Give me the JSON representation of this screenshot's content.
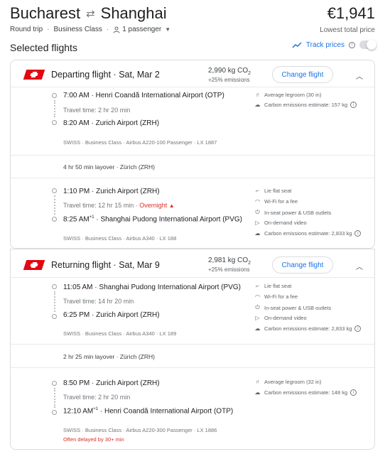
{
  "header": {
    "origin": "Bucharest",
    "swap_icon": "swap-arrows-icon",
    "destination": "Shanghai",
    "price": "€1,941",
    "price_note": "Lowest total price",
    "trip_type": "Round trip",
    "cabin": "Business Class",
    "passengers": "1 passenger"
  },
  "selected_title": "Selected flights",
  "track": {
    "label": "Track prices",
    "enabled": false
  },
  "departing": {
    "title": "Departing flight",
    "date": "Sat, Mar 2",
    "co2": "2,990 kg CO",
    "co2_sub": "2",
    "co2_pct": "+25% emissions",
    "button": "Change flight",
    "seg1": {
      "dep_time": "7:00 AM",
      "dep_airport": "Henri Coandă International Airport (OTP)",
      "travel": "Travel time: 2 hr 20 min",
      "arr_time": "8:20 AM",
      "arr_airport": "Zurich Airport (ZRH)",
      "meta": "SWISS · Business Class · Airbus A220-100 Passenger · LX 1887",
      "amenities": [
        "Average legroom (30 in)",
        "Carbon emissions estimate: 157 kg"
      ]
    },
    "layover": "4 hr 50 min layover · Zürich (ZRH)",
    "seg2": {
      "dep_time": "1:10 PM",
      "dep_airport": "Zurich Airport (ZRH)",
      "travel": "Travel time: 12 hr 15 min",
      "overnight": "Overnight",
      "arr_time": "8:25 AM",
      "arr_plus": "+1",
      "arr_airport": "Shanghai Pudong International Airport (PVG)",
      "meta": "SWISS · Business Class · Airbus A340 · LX 188",
      "amenities": [
        "Lie flat seat",
        "Wi-Fi for a fee",
        "In-seat power & USB outlets",
        "On-demand video",
        "Carbon emissions estimate: 2,833 kg"
      ]
    }
  },
  "returning": {
    "title": "Returning flight",
    "date": "Sat, Mar 9",
    "co2": "2,981 kg CO",
    "co2_sub": "2",
    "co2_pct": "+25% emissions",
    "button": "Change flight",
    "seg1": {
      "dep_time": "11:05 AM",
      "dep_airport": "Shanghai Pudong International Airport (PVG)",
      "travel": "Travel time: 14 hr 20 min",
      "arr_time": "6:25 PM",
      "arr_airport": "Zurich Airport (ZRH)",
      "meta": "SWISS · Business Class · Airbus A340 · LX 189",
      "amenities": [
        "Lie flat seat",
        "Wi-Fi for a fee",
        "In-seat power & USB outlets",
        "On-demand video",
        "Carbon emissions estimate: 2,833 kg"
      ]
    },
    "layover": "2 hr 25 min layover · Zürich (ZRH)",
    "seg2": {
      "dep_time": "8:50 PM",
      "dep_airport": "Zurich Airport (ZRH)",
      "travel": "Travel time: 2 hr 20 min",
      "arr_time": "12:10 AM",
      "arr_plus": "+1",
      "arr_airport": "Henri Coandă International Airport (OTP)",
      "meta": "SWISS · Business Class · Airbus A220-300 Passenger · LX 1886",
      "delay": "Often delayed by 30+ min",
      "amenities": [
        "Average legroom (32 in)",
        "Carbon emissions estimate: 148 kg"
      ]
    }
  },
  "colors": {
    "accent": "#1a73e8",
    "warning": "#d93025",
    "swiss": "#e30613"
  }
}
